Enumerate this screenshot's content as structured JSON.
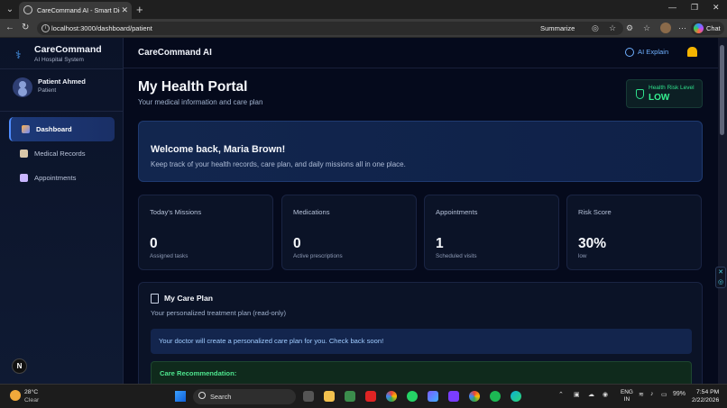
{
  "browser": {
    "tab_title": "CareCommand AI - Smart Digital H",
    "url": "localhost:3000/dashboard/patient",
    "summarize_label": "Summarize",
    "chat_label": "Chat"
  },
  "sidebar": {
    "brand_name": "CareCommand",
    "brand_sub": "AI Hospital System",
    "patient_name": "Patient Ahmed",
    "patient_role": "Patient",
    "items": [
      {
        "label": "Dashboard",
        "icon": "chart-icon",
        "active": true
      },
      {
        "label": "Medical Records",
        "icon": "document-icon",
        "active": false
      },
      {
        "label": "Appointments",
        "icon": "calendar-icon",
        "active": false
      }
    ],
    "badge": "N"
  },
  "header": {
    "title": "CareCommand AI",
    "ai_explain": "AI Explain"
  },
  "main": {
    "title": "My Health Portal",
    "subtitle": "Your medical information and care plan",
    "risk_label": "Health Risk Level",
    "risk_value": "LOW",
    "welcome_title": "Welcome back, Maria Brown!",
    "welcome_text": "Keep track of your health records, care plan, and daily missions all in one place.",
    "stats": [
      {
        "label": "Today's Missions",
        "value": "0",
        "sub": "Assigned tasks"
      },
      {
        "label": "Medications",
        "value": "0",
        "sub": "Active prescriptions"
      },
      {
        "label": "Appointments",
        "value": "1",
        "sub": "Scheduled visits"
      },
      {
        "label": "Risk Score",
        "value": "30%",
        "sub": "low"
      }
    ],
    "care_title": "My Care Plan",
    "care_sub": "Your personalized treatment plan (read-only)",
    "care_notice": "Your doctor will create a personalized care plan for you. Check back soon!",
    "care_rec_label": "Care Recommendation:"
  },
  "taskbar": {
    "temp": "28°C",
    "weather": "Clear",
    "search": "Search",
    "lang_line1": "ENG",
    "lang_line2": "IN",
    "battery": "99%",
    "time": "7:54 PM",
    "date": "2/22/2026"
  },
  "colors": {
    "accent": "#4f8dff",
    "risk_green": "#35f090",
    "bell": "#f5b400"
  }
}
